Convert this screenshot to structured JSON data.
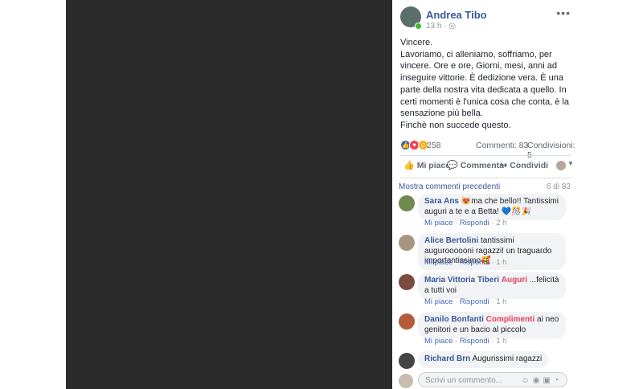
{
  "post": {
    "author": "Andrea Tibo",
    "time": "13 h",
    "privacy_icon": "globe-icon",
    "more_label": "•••",
    "text_lines": [
      "Vincere.",
      "Lavoriamo, ci alleniamo, soffriamo, per vincere. Ore e ore, Giorni, mesi, anni ad inseguire vittorie. È dedizione vera. È una parte della nostra vita dedicata a quello. In certi momenti è l'unica cosa che conta, è la sensazione più bella.",
      "Finchè non succede questo."
    ]
  },
  "stats": {
    "reactions": "258",
    "comments": "Commenti: 83",
    "shares": "Condivisioni: 5"
  },
  "actions": {
    "like": "Mi piace",
    "comment": "Commenta",
    "share": "Condividi"
  },
  "comments_header": {
    "previous": "Mostra commenti precedenti",
    "count": "6 di 83"
  },
  "comments": [
    {
      "author": "Sara Ans",
      "tag": "",
      "text": "😻ma che bello!! Tantissimi auguri a te e a Betta! 💙🎊🎉",
      "like": "Mi piace",
      "reply": "Rispondi",
      "time": "2 h",
      "avatar_color": "#6d8a4f"
    },
    {
      "author": "Alice Bertolini",
      "tag": "",
      "text": "tantissimi auguroooooni ragazzi! un traguardo importantissimo🥰",
      "like": "Mi piace",
      "reply": "Rispondi",
      "time": "1 h",
      "avatar_color": "#a89580"
    },
    {
      "author": "Maria Vittoria Tiberi",
      "tag": "Auguri",
      "text": "...felicità a tutti voi",
      "like": "Mi piace",
      "reply": "Rispondi",
      "time": "1 h",
      "avatar_color": "#7a4b3f"
    },
    {
      "author": "Danilo Bonfanti",
      "tag": "Complimenti",
      "text": "ai neo genitori e un bacio al piccolo",
      "like": "Mi piace",
      "reply": "Rispondi",
      "time": "1 h",
      "avatar_color": "#b65a3b"
    },
    {
      "author": "Richard Brn",
      "tag": "",
      "text": "Augurissimi ragazzi",
      "like": "",
      "reply": "",
      "time": "",
      "avatar_color": "#444444"
    }
  ],
  "composer": {
    "placeholder": "Scrivi un commento..."
  },
  "colors": {
    "link": "#385898",
    "like_blue": "#4267b2",
    "love_red": "#f33e58",
    "haha_yellow": "#f7b125"
  }
}
